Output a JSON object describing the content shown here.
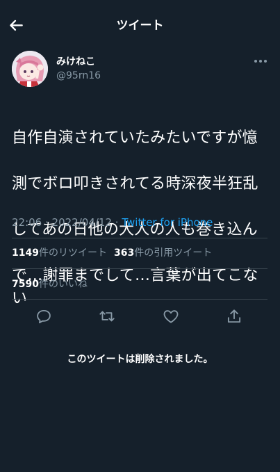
{
  "header": {
    "title": "ツイート",
    "back_icon": "arrow-left-icon"
  },
  "author": {
    "display_name": "みけねこ",
    "handle": "@95rn16"
  },
  "tweet": {
    "text_lines": [
      "自作自演されていたみたいですが憶",
      "測でボロ叩きされてる時深夜半狂乱",
      "してあの日他の大人の人も巻き込ん",
      "で…謝罪までして…言葉が出てこない"
    ],
    "time": "22:06",
    "separator": " · ",
    "date": "2022/04/12",
    "source": "Twitter for iPhone"
  },
  "stats": {
    "retweets_count": "1149",
    "retweets_label": "件のリツイート",
    "quotes_count": "363",
    "quotes_label": "件の引用ツイート",
    "likes_count": "7590",
    "likes_label": "件のいいね"
  },
  "actions": {
    "reply_icon": "reply-icon",
    "retweet_icon": "retweet-icon",
    "like_icon": "heart-icon",
    "share_icon": "share-icon"
  },
  "deleted_notice": "このツイートは削除されました。",
  "colors": {
    "background": "#15202b",
    "text": "#ffffff",
    "muted": "#8899a6",
    "accent": "#1da1f2",
    "divider": "#38444d"
  }
}
